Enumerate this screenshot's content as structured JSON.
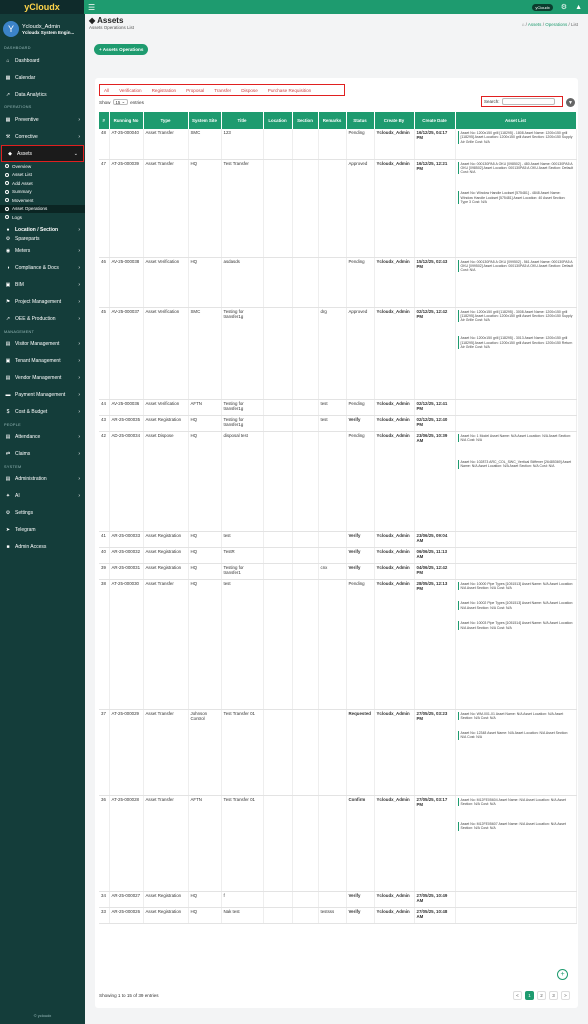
{
  "app": {
    "name": "yCloudx",
    "badge": "yCloudx"
  },
  "user": {
    "initial": "Y",
    "name": "Ycloudx_Admin",
    "company": "Ycloudx System Engin..."
  },
  "sidebar": {
    "sections": [
      "DASHBOARD",
      "OPERATIONS",
      "MANAGEMENT",
      "PEOPLE",
      "SYSTEM"
    ],
    "dashboard": [
      "Dashboard",
      "Calendar",
      "Data Analytics"
    ],
    "operations": [
      "Preventive",
      "Corrective",
      "Assets"
    ],
    "asset_subs": [
      "Overview",
      "Asset List",
      "Add Asset",
      "Summary",
      "Movement",
      "Asset Operations",
      "Logs"
    ],
    "location": "Location / Section",
    "spareparts": "Spareparts",
    "rest": [
      "Meters",
      "Compliance & Docs",
      "BIM",
      "Project Management",
      "OEE & Production"
    ],
    "management": [
      "Visitor Management",
      "Tenant Management",
      "Vendor Management",
      "Payment Management",
      "Cost & Budget"
    ],
    "people": [
      "Attendance",
      "Claims"
    ],
    "system": [
      "Administration",
      "AI",
      "Settings",
      "Telegram",
      "Admin Access"
    ],
    "footer": "© ycloudx"
  },
  "page": {
    "title": "Assets",
    "subtitle": "Assets Operations List",
    "breadcrumb": [
      "Assets",
      "Operations",
      "List"
    ],
    "button": "+ Assets Operations"
  },
  "filters": [
    "All",
    "Verification",
    "Registration",
    "Proposal",
    "Transfer",
    "Dispose",
    "Purchase Requisition"
  ],
  "table_controls": {
    "show": "Show",
    "entries_value": "15",
    "entries": "entries",
    "search": "Search:",
    "info": "Showing 1 to 15 of 39 entries",
    "pages": [
      "<",
      "1",
      "2",
      "3",
      ">"
    ]
  },
  "columns": [
    "#",
    "Running No",
    "Type",
    "System Site",
    "Title",
    "Location",
    "Section",
    "Remarks",
    "Status",
    "Create By",
    "Create Date",
    "Asset List"
  ],
  "rows": [
    {
      "n": "48",
      "run": "AT-25-000040",
      "type": "Asset Transfer",
      "site": "SMC",
      "title": "123",
      "loc": "",
      "sec": "",
      "rem": "",
      "status": "Pending",
      "by": "Ycloudx_Admin",
      "date": "16/12/25, 04:17 PM",
      "assets": [
        "Asset No: 1200x150 grill [118295] - 1808 Asset Name: 1200x150 grill [118295] Asset Location: 1200x150 grill Asset Section: 1200x150 Supply Air Grille Cost: N/A"
      ],
      "h": 30
    },
    {
      "n": "47",
      "run": "AT-25-000039",
      "type": "Asset Transfer",
      "site": "HQ",
      "title": "Test Transfer",
      "loc": "",
      "sec": "",
      "rem": "",
      "status": "Approved",
      "by": "Ycloudx_Admin",
      "date": "16/12/25, 12:21 PM",
      "assets": [
        "Asset No: 000130PA5 A OKU [098502] - 480 Asset Name: 000130PA5 A OKU [098502] Asset Location: 000130PA5 A OKU Asset Section: Default Cost: N/A",
        "Asset No: Window Handle Lockset [575481] - 4848 Asset Name: Window Handle Lockset [575481] Asset Location: 40 Asset Section: Type 3 Cost: N/A"
      ],
      "h": 98
    },
    {
      "n": "46",
      "run": "AV-25-000038",
      "type": "Asset Verification",
      "site": "HQ",
      "title": "asdasds",
      "loc": "",
      "sec": "",
      "rem": "",
      "status": "Pending",
      "by": "Ycloudx_Admin",
      "date": "15/12/25, 02:43 PM",
      "assets": [
        "Asset No: 000130PA5 A OKU [099502] - 561 Asset Name: 000130PA5 A OKU [099502] Asset Location: 000130PA5 A OKU Asset Section: Default Cost: N/A"
      ],
      "h": 50
    },
    {
      "n": "45",
      "run": "AV-25-000037",
      "type": "Asset Verification",
      "site": "SMC",
      "title": "Testing for transfer1g",
      "loc": "",
      "sec": "",
      "rem": "drg",
      "status": "Approved",
      "by": "Ycloudx_Admin",
      "date": "02/12/25, 12:42 PM",
      "assets": [
        "Asset No: 1200x150 grill [118295] - 3008 Asset Name: 1200x150 grill [118295] Asset Location: 1200x150 grill Asset Section: 1200x150 Supply Air Grille Cost: N/A",
        "Asset No: 1200x150 grill [118295] - 3013 Asset Name: 1200x150 grill [118295] Asset Location: 1200x150 grill Asset Section: 1200x150 Return Air Grille Cost: N/A"
      ],
      "h": 92
    },
    {
      "n": "44",
      "run": "AV-25-000036",
      "type": "Asset Verification",
      "site": "AFTN",
      "title": "Testing for transfer1g",
      "loc": "",
      "sec": "",
      "rem": "test",
      "status": "Pending",
      "by": "Ycloudx_Admin",
      "date": "02/12/25, 12:41 PM",
      "assets": [],
      "h": 16
    },
    {
      "n": "43",
      "run": "AR-25-000035",
      "type": "Asset Registration",
      "site": "HQ",
      "title": "Testing for transfer1g",
      "loc": "",
      "sec": "",
      "rem": "test",
      "status": "Verify",
      "by": "Ycloudx_Admin",
      "date": "02/12/25, 12:40 PM",
      "assets": [],
      "h": 16
    },
    {
      "n": "42",
      "run": "AD-25-000034",
      "type": "Asset Dispose",
      "site": "HQ",
      "title": "disposal test",
      "loc": "",
      "sec": "",
      "rem": "",
      "status": "Pending",
      "by": "Ycloudx_Admin",
      "date": "23/06/25, 10:39 AM",
      "assets": [
        "Asset No: 1 Model Asset Name: N/A Asset Location: N/A Asset Section: N/A Cost: N/A",
        "Asset No: 102873 ARC_COL_SWC_Vertical Stiffener [26485369] Asset Name: N/A Asset Location: N/A Asset Section: N/A Cost: N/A"
      ],
      "h": 100
    },
    {
      "n": "41",
      "run": "AR-25-000033",
      "type": "Asset Registration",
      "site": "HQ",
      "title": "test",
      "loc": "",
      "sec": "",
      "rem": "",
      "status": "Verify",
      "by": "Ycloudx_Admin",
      "date": "23/06/25, 09:04 AM",
      "assets": [],
      "h": 16
    },
    {
      "n": "40",
      "run": "AR-25-000032",
      "type": "Asset Registration",
      "site": "HQ",
      "title": "TestR",
      "loc": "",
      "sec": "",
      "rem": "",
      "status": "Verify",
      "by": "Ycloudx_Admin",
      "date": "06/06/25, 11:13 AM",
      "assets": [],
      "h": 16
    },
    {
      "n": "39",
      "run": "AR-25-000031",
      "type": "Asset Registration",
      "site": "HQ",
      "title": "Testing for transfer1",
      "loc": "",
      "sec": "",
      "rem": "cnx",
      "status": "Verify",
      "by": "Ycloudx_Admin",
      "date": "04/06/25, 12:42 PM",
      "assets": [],
      "h": 16
    },
    {
      "n": "38",
      "run": "AT-25-000030",
      "type": "Asset Transfer",
      "site": "HQ",
      "title": "test",
      "loc": "",
      "sec": "",
      "rem": "",
      "status": "Pending",
      "by": "Ycloudx_Admin",
      "date": "28/05/25, 12:13 PM",
      "assets": [
        "Asset No: 10000 Pipe Types [1051513] Asset Name: N/A Asset Location: N/A Asset Section: N/A Cost: N/A",
        "Asset No: 10002 Pipe Types [1051513] Asset Name: N/A Asset Location: N/A Asset Section: N/A Cost: N/A",
        "Asset No: 10003 Pipe Types [1051514] Asset Name: N/A Asset Location: N/A Asset Section: N/A Cost: N/A"
      ],
      "h": 130
    },
    {
      "n": "37",
      "run": "AT-25-000029",
      "type": "Asset Transfer",
      "site": "Johnson Control",
      "title": "Test Transfer 01",
      "loc": "",
      "sec": "",
      "rem": "",
      "status": "Requested",
      "by": "Ycloudx_Admin",
      "date": "27/05/25, 03:23 PM",
      "assets": [
        "Asset No: WM-001-01 Asset Name: N/A Asset Location: N/A Asset Section: N/A Cost: N/A",
        "Asset No: 12348 Asset Name: N/A Asset Location: N/A Asset Section: N/A Cost: N/A"
      ],
      "h": 86
    },
    {
      "n": "36",
      "run": "AT-25-000028",
      "type": "Asset Transfer",
      "site": "AFTN",
      "title": "Test Transfer 01",
      "loc": "",
      "sec": "",
      "rem": "",
      "status": "Confirm",
      "by": "Ycloudx_Admin",
      "date": "27/05/25, 03:17 PM",
      "assets": [
        "Asset No: M12FE05604 Asset Name: N/A Asset Location: N/A Asset Section: N/A Cost: N/A",
        "Asset No: M12FE05607 Asset Name: N/A Asset Location: N/A Asset Section: N/A Cost: N/A"
      ],
      "h": 96
    },
    {
      "n": "34",
      "run": "AR-25-000027",
      "type": "Asset Registration",
      "site": "HQ",
      "title": "f",
      "loc": "",
      "sec": "",
      "rem": "",
      "status": "Verify",
      "by": "Ycloudx_Admin",
      "date": "27/05/25, 10:49 AM",
      "assets": [],
      "h": 16
    },
    {
      "n": "33",
      "run": "AR-25-000026",
      "type": "Asset Registration",
      "site": "HQ",
      "title": "Nak test",
      "loc": "",
      "sec": "",
      "rem": "testsss",
      "status": "Verify",
      "by": "Ycloudx_Admin",
      "date": "27/05/25, 10:48 AM",
      "assets": [],
      "h": 16
    }
  ]
}
